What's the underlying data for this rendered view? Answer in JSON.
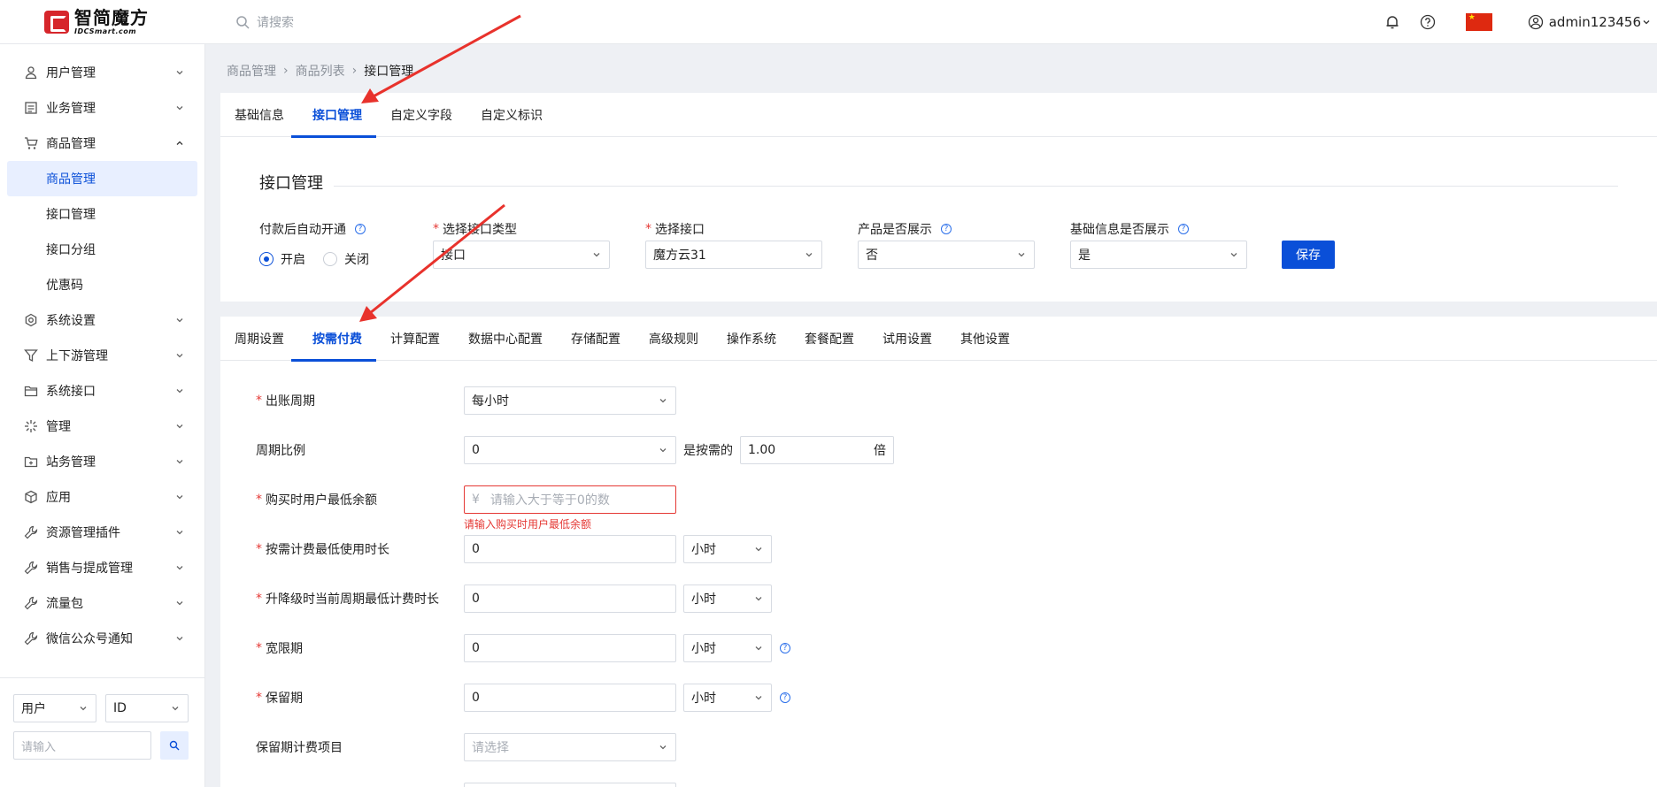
{
  "header": {
    "logo_cn": "智简魔方",
    "logo_en": "IDCSmart.com",
    "search_placeholder": "请搜索",
    "username": "admin123456"
  },
  "sidebar": {
    "items": [
      {
        "label": "用户管理",
        "icon": "user-icon"
      },
      {
        "label": "业务管理",
        "icon": "list-icon"
      },
      {
        "label": "商品管理",
        "icon": "cart-icon"
      },
      {
        "label": "商品管理",
        "icon": ""
      },
      {
        "label": "接口管理",
        "icon": ""
      },
      {
        "label": "接口分组",
        "icon": ""
      },
      {
        "label": "优惠码",
        "icon": ""
      },
      {
        "label": "系统设置",
        "icon": "gear-icon"
      },
      {
        "label": "上下游管理",
        "icon": "filter-icon"
      },
      {
        "label": "系统接口",
        "icon": "folder-icon"
      },
      {
        "label": "管理",
        "icon": "spark-icon"
      },
      {
        "label": "站务管理",
        "icon": "folder-plus-icon"
      },
      {
        "label": "应用",
        "icon": "box-icon"
      },
      {
        "label": "资源管理插件",
        "icon": "wrench-icon"
      },
      {
        "label": "销售与提成管理",
        "icon": "wrench-icon"
      },
      {
        "label": "流量包",
        "icon": "wrench-icon"
      },
      {
        "label": "微信公众号通知",
        "icon": "wrench-icon"
      }
    ],
    "filter_type": "用户",
    "filter_field": "ID",
    "filter_placeholder": "请输入"
  },
  "breadcrumb": [
    "商品管理",
    "商品列表",
    "接口管理"
  ],
  "top_tabs": [
    "基础信息",
    "接口管理",
    "自定义字段",
    "自定义标识"
  ],
  "interface": {
    "title": "接口管理",
    "auto_open_label": "付款后自动开通",
    "radio_on": "开启",
    "radio_off": "关闭",
    "type_label": "选择接口类型",
    "type_value": "接口",
    "iface_label": "选择接口",
    "iface_value": "魔方云31",
    "show_label": "产品是否展示",
    "show_value": "否",
    "base_show_label": "基础信息是否展示",
    "base_show_value": "是",
    "save": "保存"
  },
  "config_tabs": [
    "周期设置",
    "按需付费",
    "计算配置",
    "数据中心配置",
    "存储配置",
    "高级规则",
    "操作系统",
    "套餐配置",
    "试用设置",
    "其他设置"
  ],
  "form": {
    "billing_cycle_label": "出账周期",
    "billing_cycle_value": "每小时",
    "ratio_label": "周期比例",
    "ratio_value": "0",
    "ratio_mid": "是按需的",
    "ratio_mult": "1.00",
    "ratio_unit": "倍",
    "min_balance_label": "购买时用户最低余额",
    "min_balance_prefix": "¥",
    "min_balance_placeholder": "请输入大于等于0的数",
    "min_balance_error": "请输入购买时用户最低余额",
    "min_usage_label": "按需计费最低使用时长",
    "min_usage_value": "0",
    "min_usage_unit": "小时",
    "upgrade_label": "升降级时当前周期最低计费时长",
    "upgrade_value": "0",
    "upgrade_unit": "小时",
    "grace_label": "宽限期",
    "grace_value": "0",
    "grace_unit": "小时",
    "retain_label": "保留期",
    "retain_value": "0",
    "retain_unit": "小时",
    "retain_items_label": "保留期计费项目",
    "retain_items_placeholder": "请选择"
  },
  "colors": {
    "accent": "#0a4fd8",
    "error": "#e53935",
    "arrow": "#e8322c"
  }
}
